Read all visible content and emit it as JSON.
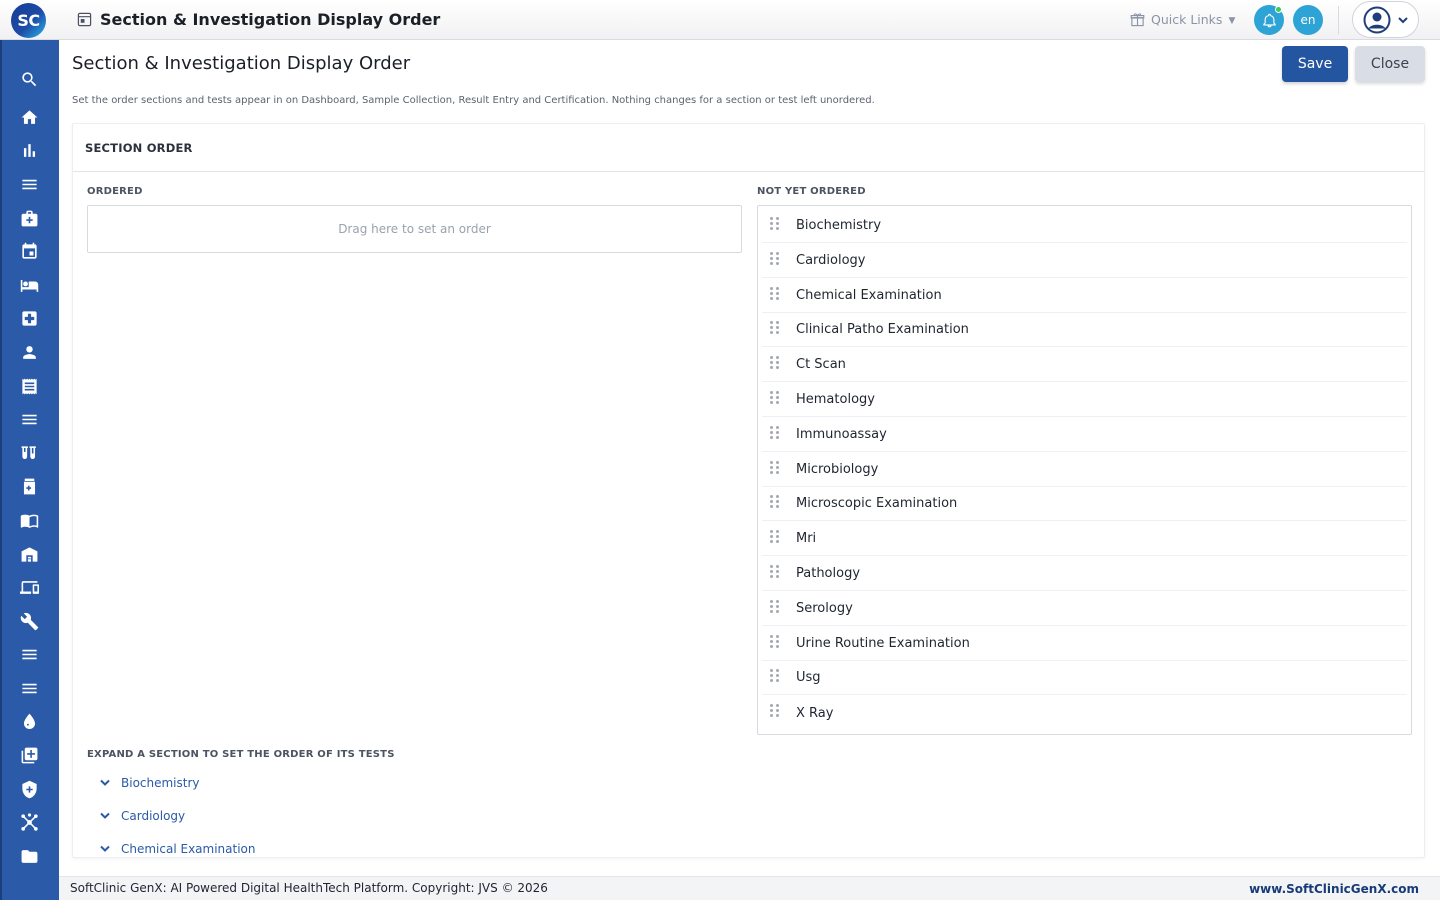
{
  "app": {
    "logo_text": "SC",
    "page_title": "Section & Investigation Display Order"
  },
  "topbar": {
    "quick_links_label": "Quick Links",
    "language": "en"
  },
  "main": {
    "title": "Section & Investigation Display Order",
    "save_label": "Save",
    "close_label": "Close",
    "description": "Set the order sections and tests appear in on Dashboard, Sample Collection, Result Entry and Certification. Nothing changes for a section or test left unordered."
  },
  "section_order": {
    "title": "SECTION ORDER",
    "ordered_label": "ORDERED",
    "dropzone_placeholder": "Drag here to set an order",
    "not_ordered_label": "NOT YET ORDERED",
    "not_ordered_items": [
      "Biochemistry",
      "Cardiology",
      "Chemical Examination",
      "Clinical Patho Examination",
      "Ct Scan",
      "Hematology",
      "Immunoassay",
      "Microbiology",
      "Microscopic Examination",
      "Mri",
      "Pathology",
      "Serology",
      "Urine Routine Examination",
      "Usg",
      "X Ray"
    ]
  },
  "tests_order": {
    "label": "EXPAND A SECTION TO SET THE ORDER OF ITS TESTS",
    "sections": [
      "Biochemistry",
      "Cardiology",
      "Chemical Examination"
    ]
  },
  "sidebar_icons": [
    "search-icon",
    "home-icon",
    "bar-chart-icon",
    "menu-icon",
    "medical-bag-icon",
    "calendar-icon",
    "bed-icon",
    "hospital-plus-icon",
    "person-icon",
    "receipt-icon",
    "list-icon",
    "test-tubes-icon",
    "medicine-bottle-icon",
    "book-open-icon",
    "warehouse-icon",
    "devices-icon",
    "wrench-icon",
    "list-icon",
    "list-icon",
    "blood-drop-icon",
    "add-box-icon",
    "shield-plus-icon",
    "network-icon",
    "folder-icon"
  ],
  "footer": {
    "copyright": "SoftClinic GenX: AI Powered Digital HealthTech Platform. Copyright: JVS © 2026",
    "website": "www.SoftClinicGenX.com"
  },
  "colors": {
    "sidebar": "#2a5aa8",
    "primary_button": "#2455a0",
    "accent": "#2ea3d6",
    "link": "#2a5aa8"
  }
}
